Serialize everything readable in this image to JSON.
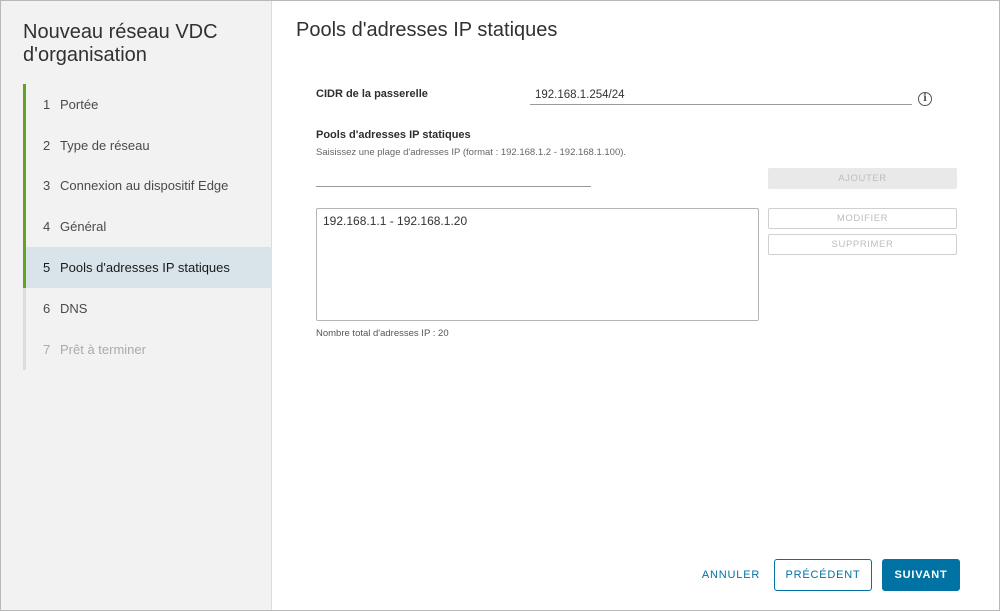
{
  "sidebar": {
    "title": "Nouveau réseau VDC d'organisation",
    "steps": [
      {
        "num": "1",
        "label": "Portée",
        "state": "done"
      },
      {
        "num": "2",
        "label": "Type de réseau",
        "state": "done"
      },
      {
        "num": "3",
        "label": "Connexion au dispositif Edge",
        "state": "done"
      },
      {
        "num": "4",
        "label": "Général",
        "state": "done"
      },
      {
        "num": "5",
        "label": "Pools d'adresses IP statiques",
        "state": "current"
      },
      {
        "num": "6",
        "label": "DNS",
        "state": "pending"
      },
      {
        "num": "7",
        "label": "Prêt à terminer",
        "state": "disabled"
      }
    ]
  },
  "main": {
    "title": "Pools d'adresses IP statiques",
    "cidr": {
      "label": "CIDR de la passerelle",
      "value": "192.168.1.254/24"
    },
    "pools": {
      "label": "Pools d'adresses IP statiques",
      "helper": "Saisissez une plage d'adresses IP (format : 192.168.1.2 - 192.168.1.100).",
      "input_value": "",
      "add_label": "AJOUTER",
      "edit_label": "MODIFIER",
      "delete_label": "SUPPRIMER",
      "items": [
        "192.168.1.1 - 192.168.1.20"
      ],
      "total": "Nombre total d'adresses IP : 20"
    }
  },
  "footer": {
    "cancel_label": "ANNULER",
    "prev_label": "PRÉCÉDENT",
    "next_label": "SUIVANT"
  },
  "colors": {
    "accent": "#0072a3",
    "step_done": "#62a420",
    "step_current_bg": "#d9e4ea"
  }
}
